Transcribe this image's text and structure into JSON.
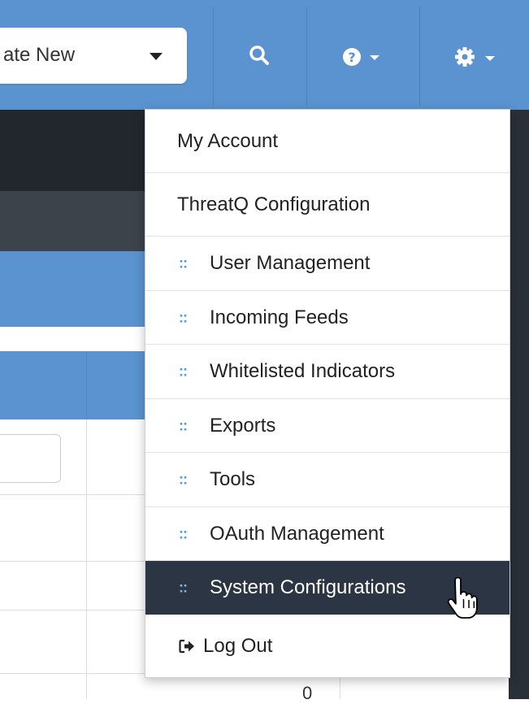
{
  "navbar": {
    "create_select": {
      "label": "ate New"
    },
    "search_icon": "search-icon",
    "help_icon": "question-circle-icon",
    "settings_icon": "gear-icon"
  },
  "table": {
    "visible_cell_value": "0"
  },
  "menu": {
    "items": [
      {
        "label": "My Account",
        "level": 0
      },
      {
        "label": "ThreatQ Configuration",
        "level": 0
      },
      {
        "label": "User Management",
        "level": 1
      },
      {
        "label": "Incoming Feeds",
        "level": 1
      },
      {
        "label": "Whitelisted Indicators",
        "level": 1
      },
      {
        "label": "Exports",
        "level": 1
      },
      {
        "label": "Tools",
        "level": 1
      },
      {
        "label": "OAuth Management",
        "level": 1
      },
      {
        "label": "System Configurations",
        "level": 1,
        "active": true
      },
      {
        "label": "Log Out",
        "level": 0,
        "icon": "sign-out-icon"
      }
    ],
    "submenu_bullet": "::"
  },
  "cursor": "hand-pointer-icon",
  "colors": {
    "navbar_blue": "#5a93cf",
    "dark_header": "#22272e",
    "active_item_bg": "#2b3544",
    "submenu_bullet": "#4a9de0"
  }
}
